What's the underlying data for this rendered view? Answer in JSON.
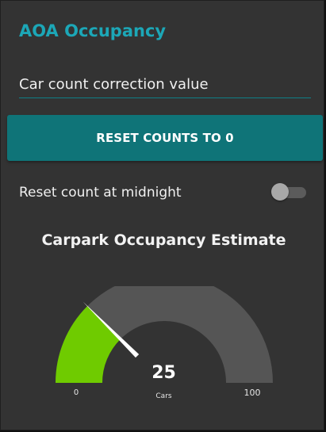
{
  "card": {
    "title": "AOA Occupancy"
  },
  "correction_input": {
    "placeholder": "Car count correction value",
    "value": ""
  },
  "reset_button": {
    "label": "RESET COUNTS TO 0"
  },
  "midnight_switch": {
    "label": "Reset count at midnight",
    "checked": false
  },
  "gauge": {
    "title": "Carpark Occupancy Estimate",
    "value": 25,
    "value_label": "25",
    "units": "Cars",
    "min": 0,
    "max": 100,
    "min_label": "0",
    "max_label": "100"
  },
  "colors": {
    "accent": "#1ca7b7",
    "button": "#0f7478",
    "card_bg": "#333333",
    "gauge_fill": "#6fcb00",
    "gauge_track": "#555555",
    "needle": "#ffffff"
  }
}
